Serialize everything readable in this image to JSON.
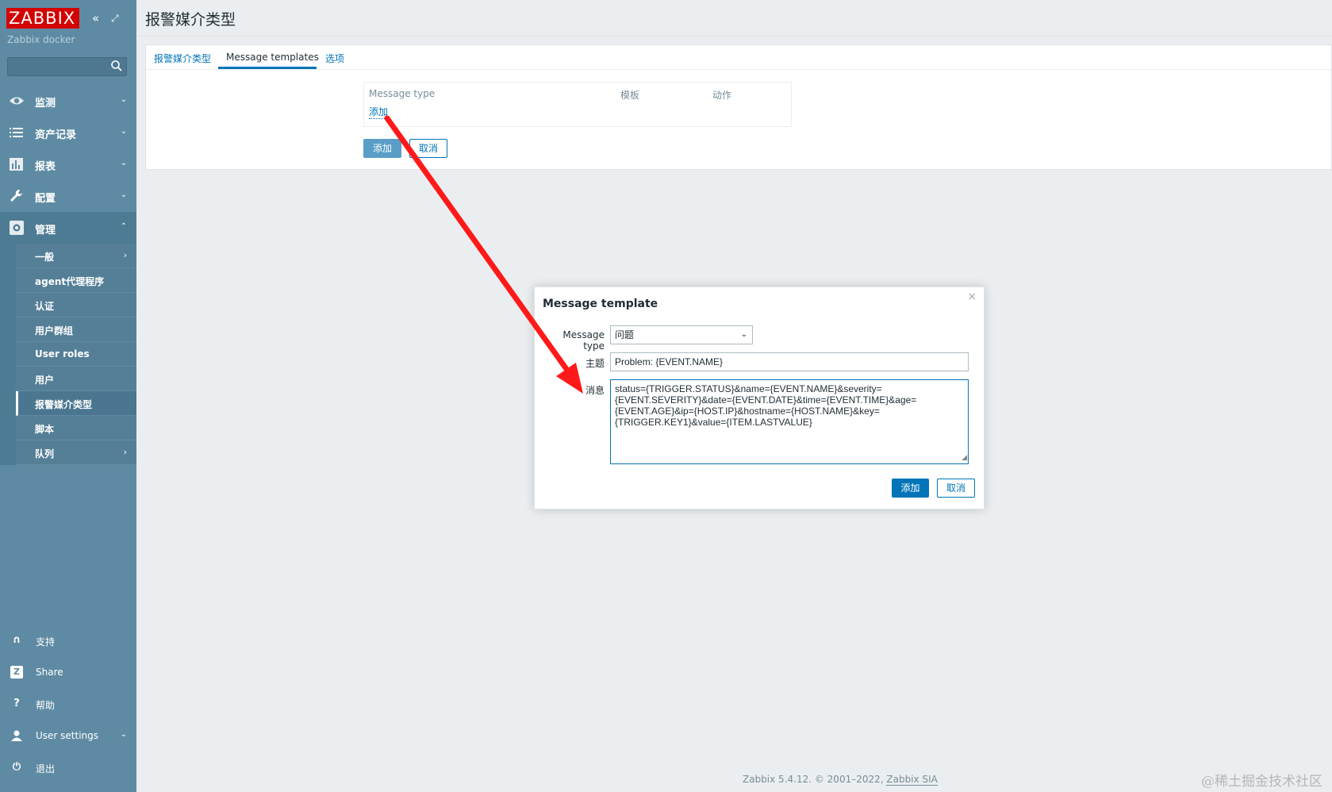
{
  "sidebar": {
    "logo": "ZABBIX",
    "server_name": "Zabbix docker",
    "search_placeholder": "",
    "menu": [
      {
        "label": "监测",
        "icon": "eye-icon"
      },
      {
        "label": "资产记录",
        "icon": "list-icon"
      },
      {
        "label": "报表",
        "icon": "bar-chart-icon"
      },
      {
        "label": "配置",
        "icon": "wrench-icon"
      },
      {
        "label": "管理",
        "icon": "gear-icon"
      }
    ],
    "submenu": [
      {
        "label": "一般"
      },
      {
        "label": "agent代理程序"
      },
      {
        "label": "认证"
      },
      {
        "label": "用户群组"
      },
      {
        "label": "User roles"
      },
      {
        "label": "用户"
      },
      {
        "label": "报警媒介类型"
      },
      {
        "label": "脚本"
      },
      {
        "label": "队列"
      }
    ],
    "bottom": [
      {
        "label": "支持",
        "icon": "headset-icon"
      },
      {
        "label": "Share",
        "icon": "share-icon"
      },
      {
        "label": "帮助",
        "icon": "help-icon"
      },
      {
        "label": "User settings",
        "icon": "user-icon"
      },
      {
        "label": "退出",
        "icon": "power-icon"
      }
    ]
  },
  "header": {
    "title": "报警媒介类型"
  },
  "tabs": [
    "报警媒介类型",
    "Message templates",
    "选项"
  ],
  "table": {
    "columns": [
      "Message type",
      "模板",
      "动作"
    ],
    "add_link": "添加"
  },
  "buttons": {
    "add": "添加",
    "cancel": "取消"
  },
  "modal": {
    "title": "Message template",
    "close": "×",
    "message_type_label": "Message type",
    "message_type_value": "问题",
    "subject_label": "主题",
    "subject_value": "Problem: {EVENT.NAME}",
    "message_label": "消息",
    "message_value": "status={TRIGGER.STATUS}&name={EVENT.NAME}&severity=\n{EVENT.SEVERITY}&date={EVENT.DATE}&time={EVENT.TIME}&age=\n{EVENT.AGE}&ip={HOST.IP}&hostname={HOST.NAME}&key=\n{TRIGGER.KEY1}&value={ITEM.LASTVALUE}",
    "add": "添加",
    "cancel": "取消"
  },
  "footer": {
    "text": "Zabbix 5.4.12. © 2001–2022, ",
    "company": "Zabbix SIA"
  },
  "watermark": "@稀土掘金技术社区",
  "colors": {
    "sidebar": "#5e8ba3",
    "accent": "#0275b8",
    "logo": "#d40000",
    "arrow": "#ff1a1a"
  }
}
